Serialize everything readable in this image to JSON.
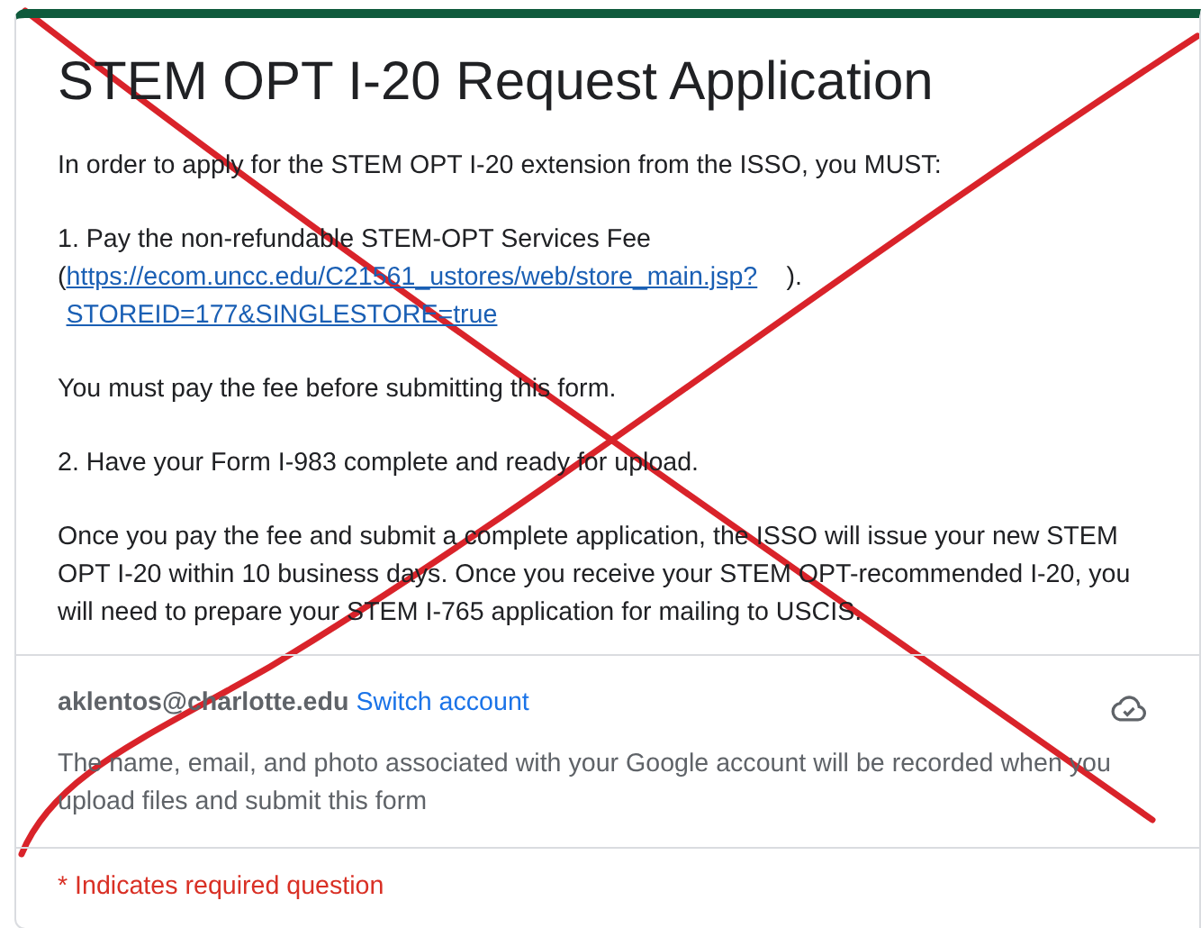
{
  "form": {
    "title": "STEM OPT I-20 Request Application",
    "description": [
      {
        "kind": "text",
        "text": "In order to apply for the STEM OPT I-20 extension from the ISSO, you MUST:"
      },
      {
        "kind": "link",
        "before": "1. Pay the non-refundable STEM-OPT Services Fee",
        "open": "(",
        "link": "https://ecom.uncc.edu/C21561_ustores/web/store_main.jsp?STOREID=177&SINGLESTORE=true",
        "after": ")."
      },
      {
        "kind": "text",
        "text": "You must pay the fee before submitting this form."
      },
      {
        "kind": "text",
        "text": "2. Have your Form I-983 complete and ready for upload."
      },
      {
        "kind": "text",
        "text": "Once you pay the fee and submit a complete application, the ISSO will issue your new STEM OPT I-20 within 10 business days. Once you receive your STEM OPT-recommended I-20, you will need to prepare your STEM I-765 application for mailing to USCIS."
      }
    ]
  },
  "account": {
    "email": "aklentos@charlotte.edu",
    "switch_link": "Switch account",
    "notice": "The name, email, and photo associated with your Google account will be recorded when you upload files and submit this form"
  },
  "required_note": "* Indicates required question"
}
